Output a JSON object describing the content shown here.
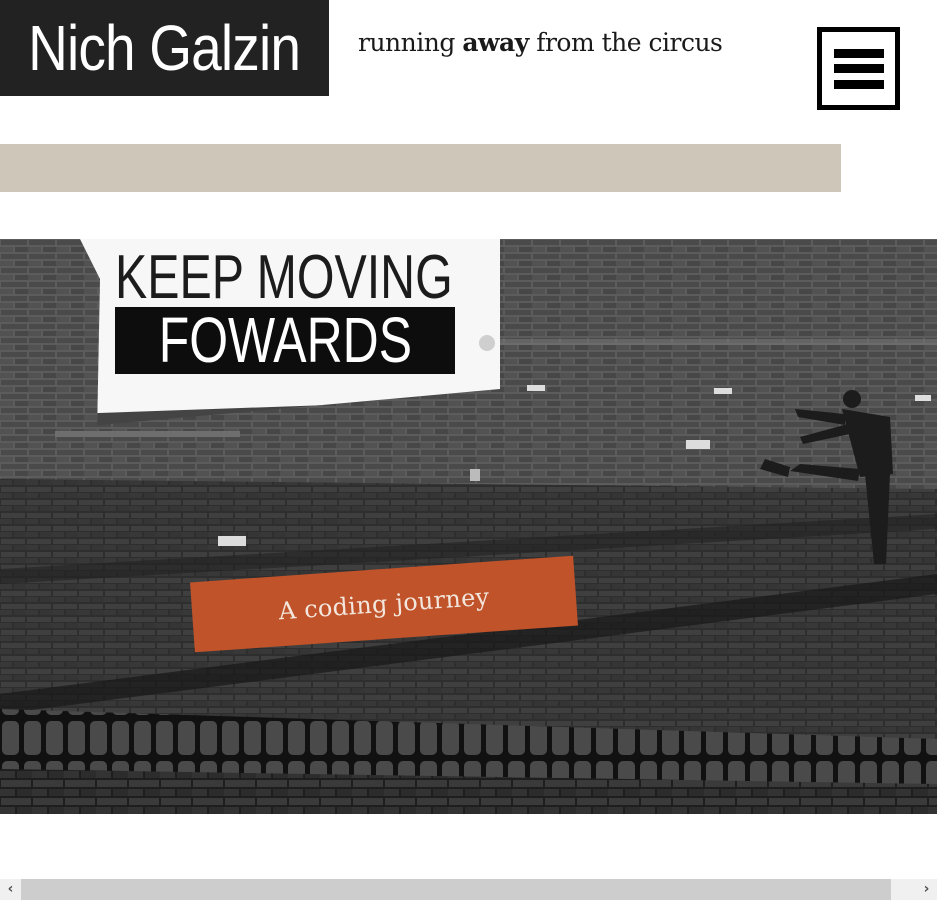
{
  "site": {
    "name": "Nich Galzin",
    "tagline_pre": "running ",
    "tagline_bold": "away",
    "tagline_post": " from the circus"
  },
  "hero": {
    "headline_line1": "KEEP MOVING",
    "headline_line2": "FOWARDS",
    "cta_label": "A coding journey"
  },
  "colors": {
    "logo_bg": "#222222",
    "band": "#cdc6b9",
    "cta": "#c0532a"
  },
  "icons": {
    "menu": "hamburger-icon",
    "scroll_left": "chevron-left-icon",
    "scroll_right": "chevron-right-icon"
  },
  "scrollbar": {
    "left_glyph": "‹",
    "right_glyph": "›"
  }
}
